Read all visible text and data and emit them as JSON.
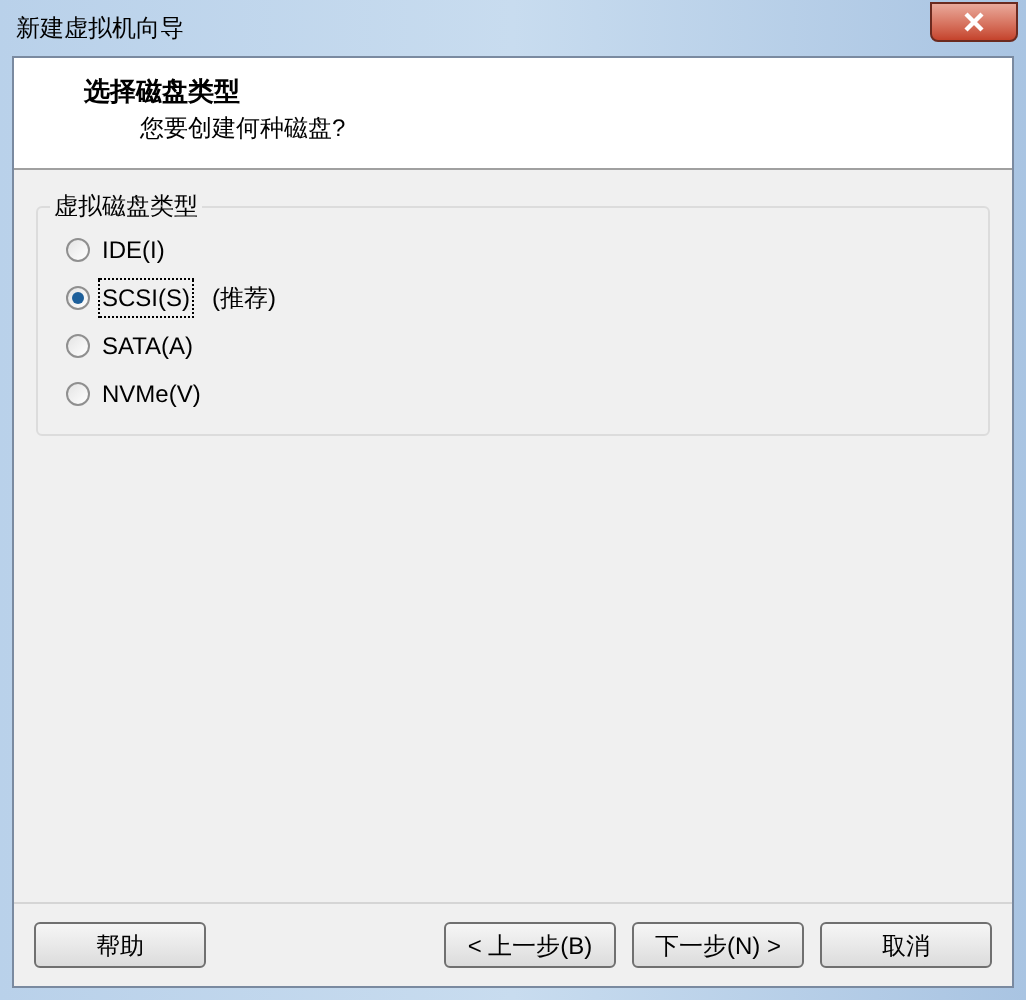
{
  "window": {
    "title": "新建虚拟机向导"
  },
  "header": {
    "title": "选择磁盘类型",
    "subtitle": "您要创建何种磁盘?"
  },
  "group": {
    "title": "虚拟磁盘类型",
    "options": [
      {
        "label": "IDE(I)",
        "selected": false
      },
      {
        "label": "SCSI(S)",
        "note": "(推荐)",
        "selected": true
      },
      {
        "label": "SATA(A)",
        "selected": false
      },
      {
        "label": "NVMe(V)",
        "selected": false
      }
    ]
  },
  "buttons": [
    {
      "label": "帮助",
      "kind": "help"
    },
    {
      "label": "< 上一步(B)",
      "kind": "back"
    },
    {
      "label": "下一步(N) >",
      "kind": "default"
    },
    {
      "label": "取消",
      "kind": "cancel"
    }
  ]
}
